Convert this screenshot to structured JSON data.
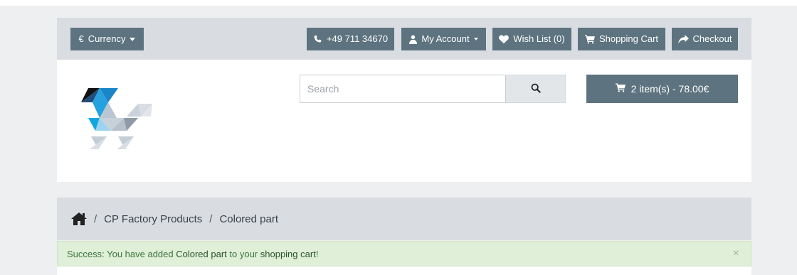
{
  "top_bar": {
    "currency_label": "Currency",
    "currency_symbol": "€",
    "phone": "+49 711 34670",
    "account_label": "My Account",
    "wishlist_label": "Wish List (0)",
    "cart_label": "Shopping Cart",
    "checkout_label": "Checkout"
  },
  "search": {
    "placeholder": "Search",
    "value": ""
  },
  "cart_summary": {
    "label": "2 item(s) - 78.00€"
  },
  "breadcrumb": {
    "items": [
      "CP Factory Products",
      "Colored part"
    ],
    "separator": "/"
  },
  "alert": {
    "prefix": "Success: You have added ",
    "product": "Colored part",
    "middle": " to your ",
    "link": "shopping cart",
    "suffix": "!",
    "close": "×"
  },
  "colors": {
    "button_bg": "#5d737f",
    "bar_bg": "#d9dde2",
    "alert_bg": "#dfefd8",
    "alert_text": "#3c763d"
  },
  "icons": {
    "phone": "phone-icon",
    "user": "user-icon",
    "heart": "heart-icon",
    "cart": "cart-icon",
    "checkout": "share-arrow-icon",
    "search": "search-icon",
    "home": "home-icon"
  }
}
